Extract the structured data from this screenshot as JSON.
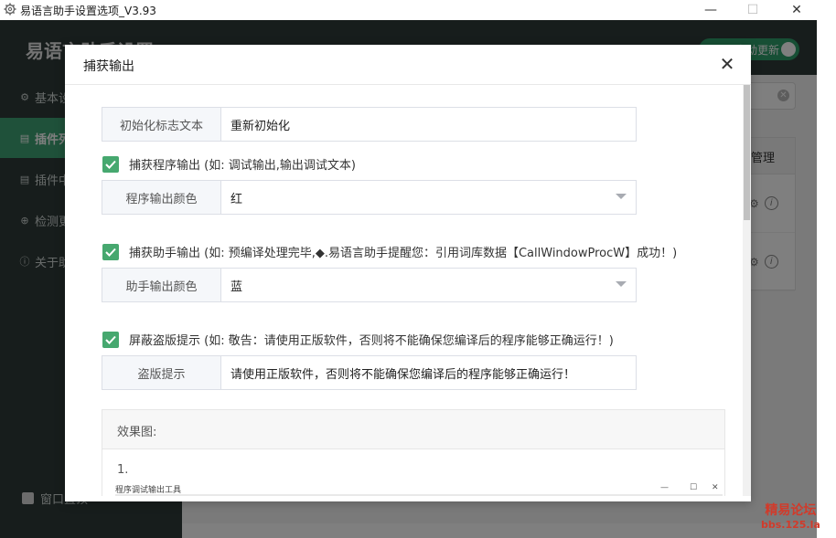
{
  "window": {
    "title": "易语言助手设置选项_V3.93",
    "minimize": "—",
    "maximize": "☐",
    "close": "✕"
  },
  "app": {
    "header_title": "易语言助手设置",
    "auto_update_label": "自动更新",
    "sidebar": [
      {
        "icon": "gear-icon",
        "glyph": "⚙",
        "label": "基本设置",
        "active": false
      },
      {
        "icon": "document-icon",
        "glyph": "▤",
        "label": "插件列表",
        "active": true
      },
      {
        "icon": "document-icon",
        "glyph": "▤",
        "label": "插件中心",
        "active": false
      },
      {
        "icon": "download-icon",
        "glyph": "⊕",
        "label": "检测更新",
        "active": false
      },
      {
        "icon": "info-icon",
        "glyph": "ⓘ",
        "label": "关于助手",
        "active": false
      }
    ],
    "window_top_label": "窗口置顶",
    "table_header": "管理",
    "search_clear": "✕"
  },
  "dialog": {
    "title": "捕获输出",
    "close": "✕",
    "init_flag": {
      "label": "初始化标志文本",
      "value": "重新初始化"
    },
    "capture_program": {
      "checked": true,
      "text": "捕获程序输出 (如: 调试输出,输出调试文本)",
      "color_label": "程序输出颜色",
      "color_value": "红"
    },
    "capture_helper": {
      "checked": true,
      "text": "捕获助手输出 (如: 预编译处理完毕,◆.易语言助手提醒您：引用词库数据【CallWindowProcW】成功！)",
      "color_label": "助手输出颜色",
      "color_value": "蓝"
    },
    "block_piracy": {
      "checked": true,
      "text": "屏蔽盗版提示 (如: 敬告：请使用正版软件，否则将不能确保您编译后的程序能够正确运行！)",
      "piracy_label": "盗版提示",
      "piracy_value": "请使用正版软件，否则将不能确保您编译后的程序能够正确运行！"
    },
    "preview": {
      "heading": "效果图:",
      "item_number": "1.",
      "mini_window_title": "程序调试输出工具"
    }
  },
  "watermark": {
    "line1": "精易论坛",
    "line2": "bbs.125.la"
  },
  "colors": {
    "accent_green": "#46a86f",
    "sidebar_active": "#3fa374",
    "sidebar_bg": "#2f3a38"
  }
}
